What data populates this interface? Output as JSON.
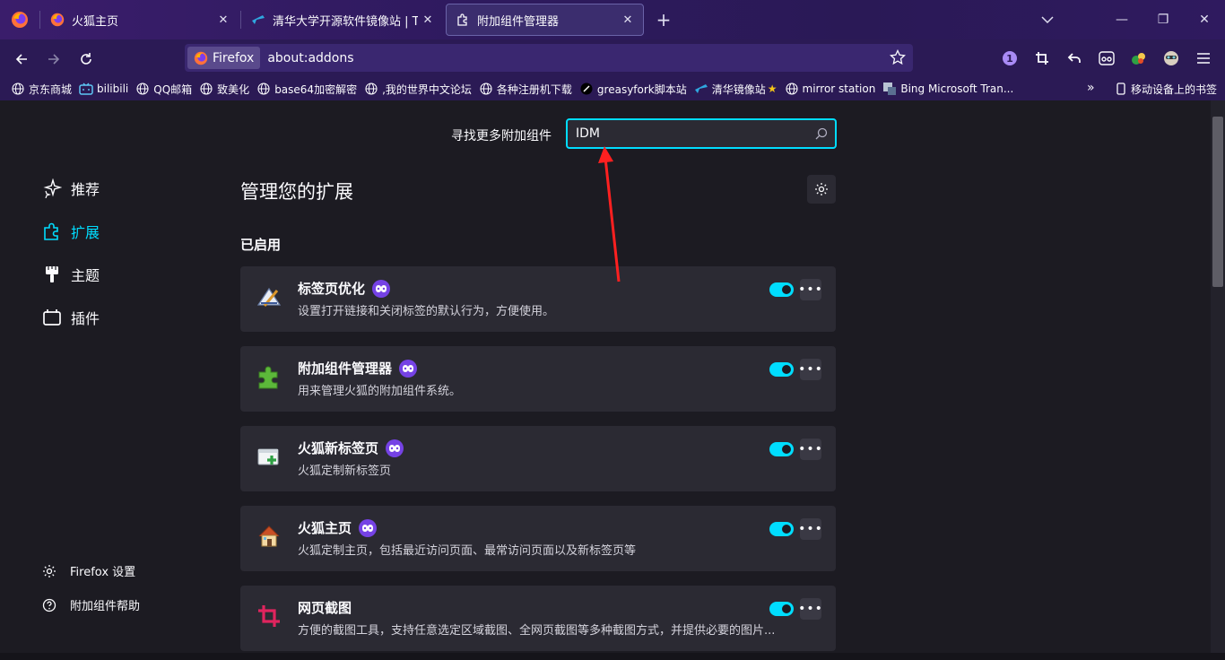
{
  "tabs": [
    {
      "title": "火狐主页",
      "close": "✕"
    },
    {
      "title": "清华大学开源软件镜像站 | Tsing",
      "close": "✕"
    },
    {
      "title": "附加组件管理器",
      "close": "✕"
    }
  ],
  "newtab_label": "+",
  "window_controls": {
    "minimize": "—",
    "restore": "❐",
    "close": "✕"
  },
  "navbar": {
    "identity_label": "Firefox",
    "url": "about:addons",
    "extension_badge_count": "1"
  },
  "bookmarks": [
    {
      "label": "京东商城",
      "icon": "globe-icon"
    },
    {
      "label": "bilibili",
      "icon": "bilibili-icon"
    },
    {
      "label": "QQ邮箱",
      "icon": "globe-icon"
    },
    {
      "label": "致美化",
      "icon": "globe-icon"
    },
    {
      "label": "base64加密解密",
      "icon": "globe-icon"
    },
    {
      "label": ",我的世界中文论坛",
      "icon": "globe-icon"
    },
    {
      "label": "各种注册机下载",
      "icon": "globe-icon"
    },
    {
      "label": "greasyfork脚本站",
      "icon": "greasyfork-icon"
    },
    {
      "label": "清华镜像站",
      "icon": "tuna-icon"
    },
    {
      "label": "mirror station",
      "icon": "globe-icon"
    },
    {
      "label": "Bing Microsoft Tran...",
      "icon": "bing-translator-icon"
    }
  ],
  "bookmarks_overflow": "»",
  "mobile_bookmarks": "移动设备上的书签",
  "search": {
    "label": "寻找更多附加组件",
    "value": "IDM"
  },
  "categories": [
    {
      "label": "推荐",
      "icon": "sparkle-icon",
      "selected": false
    },
    {
      "label": "扩展",
      "icon": "puzzle-icon",
      "selected": true
    },
    {
      "label": "主题",
      "icon": "brush-icon",
      "selected": false
    },
    {
      "label": "插件",
      "icon": "plugin-icon",
      "selected": false
    }
  ],
  "footer": {
    "settings": "Firefox 设置",
    "help": "附加组件帮助"
  },
  "page_heading": "管理您的扩展",
  "section_heading": "已启用",
  "more_label": "•••",
  "addons": [
    {
      "name": "标签页优化",
      "description": "设置打开链接和关闭标签的默认行为，方便使用。",
      "enabled": true,
      "icon": "tab-options-icon"
    },
    {
      "name": "附加组件管理器",
      "description": "用来管理火狐的附加组件系统。",
      "enabled": true,
      "icon": "green-puzzle-icon"
    },
    {
      "name": "火狐新标签页",
      "description": "火狐定制新标签页",
      "enabled": true,
      "icon": "new-tab-icon"
    },
    {
      "name": "火狐主页",
      "description": "火狐定制主页，包括最近访问页面、最常访问页面以及新标签页等",
      "enabled": true,
      "icon": "home-icon"
    },
    {
      "name": "网页截图",
      "description": "方便的截图工具，支持任意选定区域截图、全网页截图等多种截图方式，并提供必要的图片...",
      "enabled": true,
      "icon": "crop-icon"
    }
  ],
  "colors": {
    "accent": "#00ddff",
    "badge": "#7542e5",
    "card": "#2b2a33",
    "background": "#1c1b22",
    "annotation_arrow": "#ff2020"
  }
}
